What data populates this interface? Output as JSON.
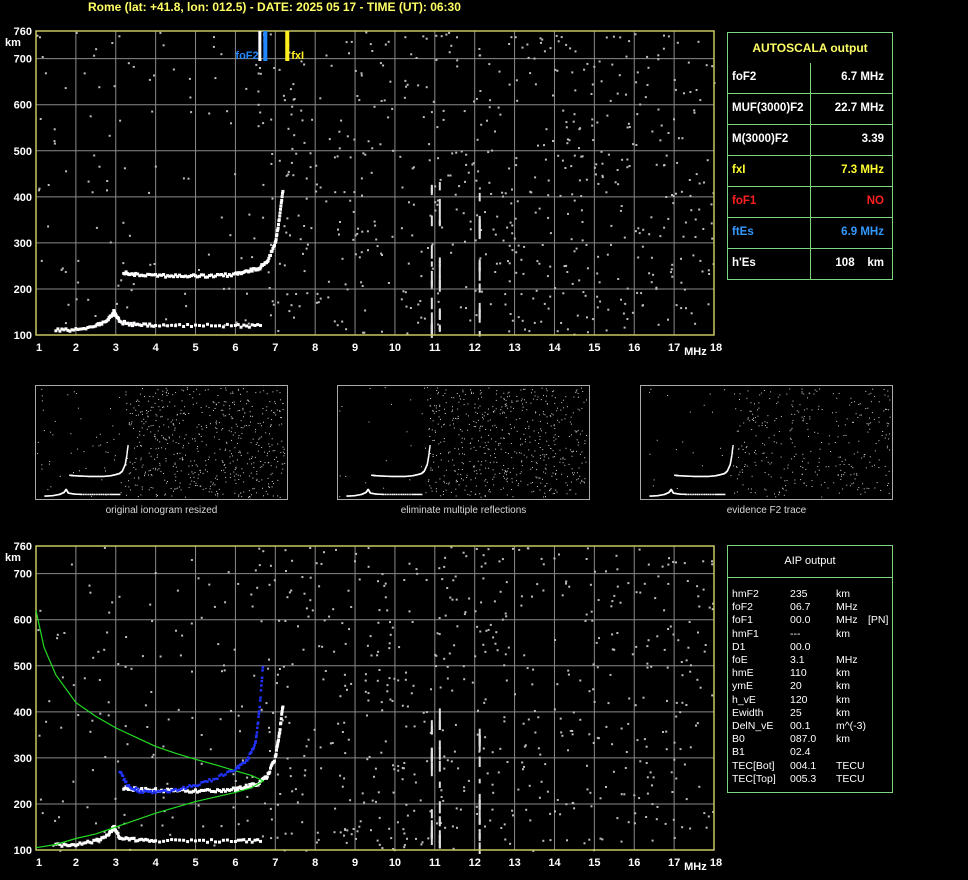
{
  "header": {
    "title": "Rome (lat: +41.8, lon: 012.5) - DATE: 2025 05 17 - TIME (UT): 06:30"
  },
  "axes": {
    "y_ticks": [
      "760",
      "700",
      "600",
      "500",
      "400",
      "300",
      "200",
      "100"
    ],
    "y_unit": "km",
    "x_ticks": [
      "1",
      "2",
      "3",
      "4",
      "5",
      "6",
      "7",
      "8",
      "9",
      "10",
      "11",
      "12",
      "13",
      "14",
      "15",
      "16",
      "17",
      "18"
    ],
    "x_unit": "MHz"
  },
  "markers": {
    "fof2": "foF2",
    "fxi": "fxI"
  },
  "autoscala": {
    "title": "AUTOSCALA output",
    "rows": [
      {
        "label": "foF2",
        "value": "6.7 MHz",
        "color": "#ffffff"
      },
      {
        "label": "MUF(3000)F2",
        "value": "22.7 MHz",
        "color": "#ffffff"
      },
      {
        "label": "M(3000)F2",
        "value": "3.39",
        "color": "#ffffff"
      },
      {
        "label": "fxI",
        "value": "7.3 MHz",
        "color": "#ffff33"
      },
      {
        "label": "foF1",
        "value": "NO",
        "color": "#ff2020"
      },
      {
        "label": "ftEs",
        "value": "6.9 MHz",
        "color": "#3399ff"
      },
      {
        "label": "h'Es",
        "value": "108    km",
        "color": "#ffffff"
      }
    ]
  },
  "thumbnails": {
    "captions": [
      "original ionogram resized",
      "eliminate multiple reflections",
      "evidence F2 trace"
    ]
  },
  "aip": {
    "title": "AIP output",
    "rows": [
      {
        "name": "hmF2",
        "value": "235",
        "unit": "km",
        "extra": ""
      },
      {
        "name": "foF2",
        "value": "06.7",
        "unit": "MHz",
        "extra": ""
      },
      {
        "name": "foF1",
        "value": "00.0",
        "unit": "MHz",
        "extra": "[PN]"
      },
      {
        "name": "hmF1",
        "value": "---",
        "unit": "km",
        "extra": ""
      },
      {
        "name": "D1",
        "value": "00.0",
        "unit": "",
        "extra": ""
      },
      {
        "name": "foE",
        "value": "3.1",
        "unit": "MHz",
        "extra": ""
      },
      {
        "name": "hmE",
        "value": "110",
        "unit": "km",
        "extra": ""
      },
      {
        "name": "ymE",
        "value": "20",
        "unit": "km",
        "extra": ""
      },
      {
        "name": "h_vE",
        "value": "120",
        "unit": "km",
        "extra": ""
      },
      {
        "name": "Ewidth",
        "value": "25",
        "unit": "km",
        "extra": ""
      },
      {
        "name": "DelN_vE",
        "value": "00.1",
        "unit": "m^(-3)",
        "extra": ""
      },
      {
        "name": "B0",
        "value": "087.0",
        "unit": "km",
        "extra": ""
      },
      {
        "name": "B1",
        "value": "02.4",
        "unit": "",
        "extra": ""
      },
      {
        "name": "TEC[Bot]",
        "value": "004.1",
        "unit": "TECU",
        "extra": ""
      },
      {
        "name": "TEC[Top]",
        "value": "005.3",
        "unit": "TECU",
        "extra": ""
      }
    ]
  },
  "colors": {
    "frame": "#c8c864",
    "grid": "#8a8a8a",
    "trace": "#ffffff",
    "profile": "#22dd22",
    "aip_trace": "#2233ff",
    "es_marker": "#2288ff",
    "fxi_marker": "#ffee22",
    "table_border": "#7fd47f"
  },
  "chart_data": [
    {
      "type": "scatter",
      "title": "",
      "xlabel": "MHz",
      "ylabel": "km",
      "xlim": [
        1,
        18
      ],
      "ylim": [
        100,
        760
      ],
      "grid": true,
      "series": [
        {
          "name": "",
          "x": [
            1.5,
            2.0,
            2.5,
            2.8,
            2.95,
            3.1,
            3.5,
            4.0,
            5.0,
            6.0,
            6.7
          ],
          "y": [
            110,
            112,
            120,
            132,
            150,
            128,
            122,
            120,
            120,
            120,
            120
          ]
        },
        {
          "name": "",
          "x": [
            3.2,
            3.5,
            4.0,
            4.5,
            5.0,
            5.5,
            6.0,
            6.3,
            6.6,
            6.8,
            7.0,
            7.1,
            7.2
          ],
          "y": [
            235,
            232,
            230,
            228,
            228,
            228,
            232,
            238,
            245,
            260,
            300,
            350,
            420
          ]
        }
      ]
    },
    {
      "type": "line",
      "title": "",
      "xlabel": "MHz",
      "ylabel": "km",
      "xlim": [
        1,
        18
      ],
      "ylim": [
        100,
        760
      ],
      "grid": true,
      "series": [
        {
          "name": "",
          "x": [
            1.0,
            1.2,
            1.5,
            2.0,
            2.5,
            3.0,
            3.5,
            4.0,
            4.5,
            5.0,
            5.5,
            6.0,
            6.4,
            6.7,
            6.4,
            6.0,
            5.0,
            4.0,
            3.0,
            2.5,
            2.0,
            1.5,
            1.0
          ],
          "y": [
            620,
            540,
            480,
            420,
            390,
            365,
            345,
            325,
            310,
            297,
            285,
            272,
            262,
            250,
            235,
            225,
            205,
            180,
            150,
            135,
            125,
            112,
            105
          ]
        },
        {
          "name": "",
          "x": [
            3.1,
            3.3,
            3.6,
            4.0,
            4.5,
            5.0,
            5.5,
            6.0,
            6.3,
            6.5,
            6.6,
            6.7
          ],
          "y": [
            270,
            240,
            228,
            225,
            230,
            240,
            255,
            275,
            295,
            330,
            400,
            510
          ]
        }
      ]
    }
  ]
}
